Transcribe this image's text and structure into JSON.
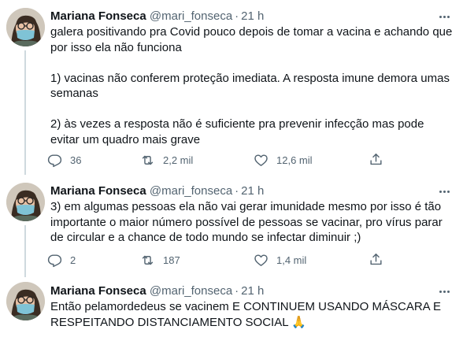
{
  "tweets": [
    {
      "author_name": "Mariana Fonseca",
      "handle": "@mari_fonseca",
      "separator": "·",
      "time": "21 h",
      "text": "galera positivando pra Covid pouco depois de tomar a vacina e achando que por isso ela não funciona\n\n1) vacinas não conferem proteção imediata. A resposta imune demora umas semanas\n\n2) às vezes a resposta não é suficiente pra prevenir infecção mas pode evitar um quadro mais grave",
      "replies": "36",
      "retweets": "2,2 mil",
      "likes": "12,6 mil"
    },
    {
      "author_name": "Mariana Fonseca",
      "handle": "@mari_fonseca",
      "separator": "·",
      "time": "21 h",
      "text": "3) em algumas pessoas ela não vai gerar imunidade mesmo por isso é tão importante o maior número possível de pessoas se vacinar, pro vírus parar de circular e a chance de todo mundo se infectar diminuir ;)",
      "replies": "2",
      "retweets": "187",
      "likes": "1,4 mil"
    },
    {
      "author_name": "Mariana Fonseca",
      "handle": "@mari_fonseca",
      "separator": "·",
      "time": "21 h",
      "text": "Então pelamordedeus se vacinem E CONTINUEM USANDO MÁSCARA E RESPEITANDO DISTANCIAMENTO SOCIAL 🙏"
    }
  ],
  "icons": {
    "reply": "reply-icon",
    "retweet": "retweet-icon",
    "like": "like-icon",
    "share": "share-icon",
    "more": "more-options-icon"
  },
  "colors": {
    "text": "#0f1419",
    "secondary": "#536471",
    "divider": "#eff3f4",
    "mask": "#7fc3d6"
  }
}
